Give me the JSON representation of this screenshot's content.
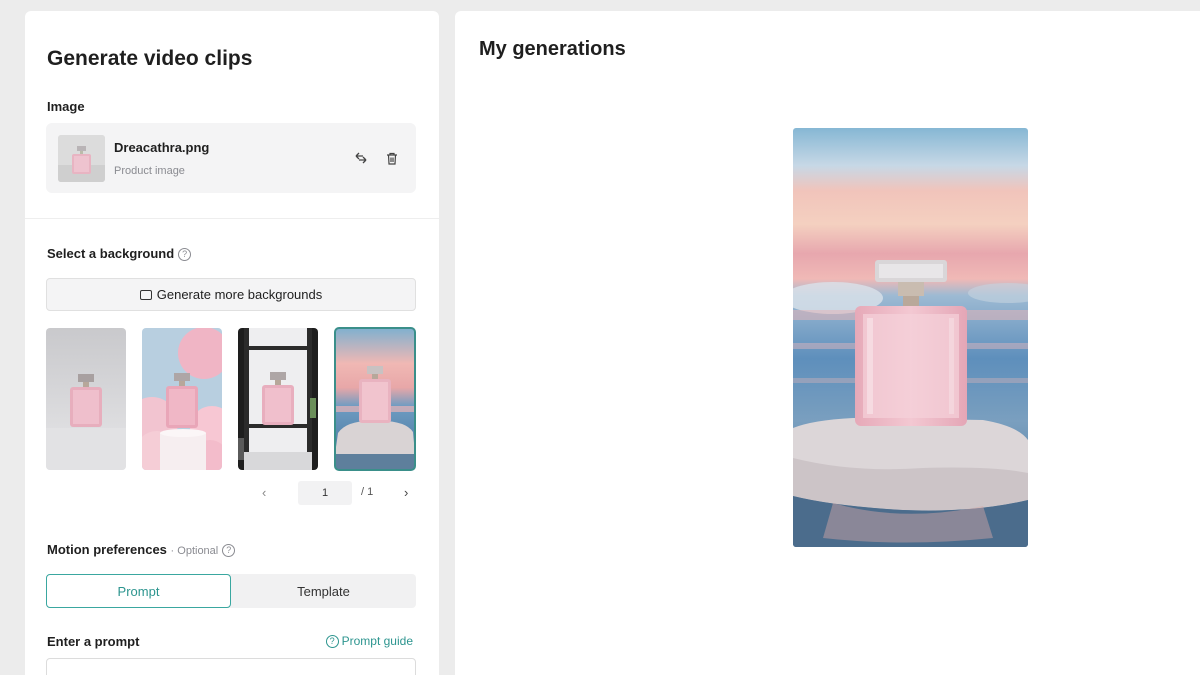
{
  "left": {
    "title": "Generate video clips",
    "image_label": "Image",
    "image_file": {
      "name": "Dreacathra.png",
      "sub": "Product image",
      "replace_icon": "replace-icon",
      "delete_icon": "trash-icon"
    },
    "background_label": "Select a background",
    "generate_more_label": "Generate more backgrounds",
    "backgrounds": [
      "grey-studio",
      "pink-clouds",
      "glass-display",
      "sunset-rock"
    ],
    "selected_background": 4,
    "pager": {
      "current": "1",
      "total": "/ 1",
      "prev_icon": "chevron-left-icon",
      "next_icon": "chevron-right-icon"
    },
    "motion_label": "Motion preferences",
    "motion_optional": "· Optional",
    "tabs": {
      "prompt": "Prompt",
      "template": "Template",
      "active": "prompt"
    },
    "prompt_label": "Enter a prompt",
    "prompt_guide": "Prompt guide",
    "prompt_value": ""
  },
  "right": {
    "title": "My generations"
  },
  "colors": {
    "accent": "#2d958f",
    "panel_bg": "#ffffff",
    "page_bg": "#ececec"
  }
}
